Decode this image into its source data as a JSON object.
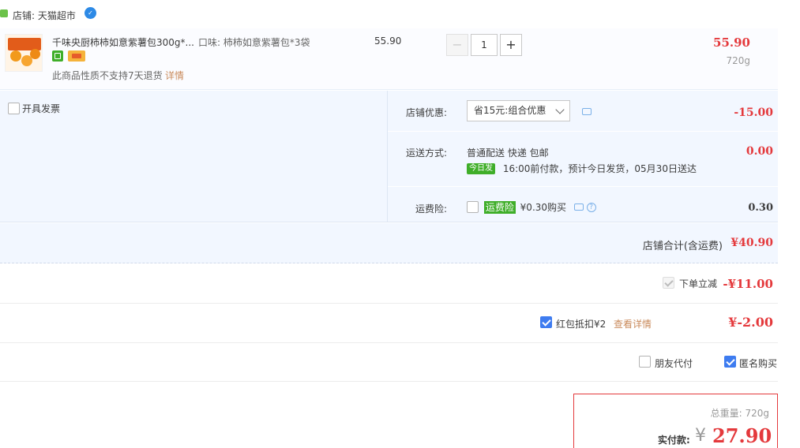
{
  "store": {
    "label": "店铺: 天猫超市",
    "chat_icon": "wangwang-chat-icon"
  },
  "item": {
    "title": "千味央厨柿柿如意紫薯包300g*...",
    "flavor": "口味: 柿柿如意紫薯包*3袋",
    "return_note": "此商品性质不支持7天退货",
    "return_detail": "详情",
    "unit_price": "55.90",
    "quantity": "1",
    "minus": "−",
    "plus": "+",
    "line_total": "55.90",
    "weight": "720g"
  },
  "invoice": {
    "label": "开具发票"
  },
  "options": {
    "coupon_label": "店铺优惠:",
    "coupon_value": "省15元:组合优惠",
    "coupon_discount": "-15.00",
    "shipping_label": "运送方式:",
    "shipping_method": "普通配送 快递 包邮",
    "today_badge": "今日发",
    "shipping_note": "16:00前付款，预计今日发货，05月30日送达",
    "shipping_fee": "0.00",
    "insurance_label": "运费险:",
    "insurance_badge": "运费险",
    "insurance_price": "¥0.30购买",
    "insurance_fee": "0.30"
  },
  "store_total": {
    "label": "店铺合计(含运费)",
    "value": "¥40.90"
  },
  "discounts": {
    "instant_label": "下单立减",
    "instant_value": "-¥11.00",
    "redpacket_label": "红包抵扣¥2",
    "redpacket_detail": "查看详情",
    "redpacket_value": "¥-2.00",
    "friend_pay_label": "朋友代付",
    "anonymous_label": "匿名购买"
  },
  "pay": {
    "weight_label": "总重量:  720g",
    "label": "实付款:",
    "currency": "¥",
    "amount": "27.90"
  },
  "colors": {
    "accent_red": "#e4393c",
    "panel_blue": "#f2f7ff",
    "checkbox_blue": "#3e7cf0",
    "badge_green": "#3fae29",
    "link_tan": "#c98a5b"
  }
}
